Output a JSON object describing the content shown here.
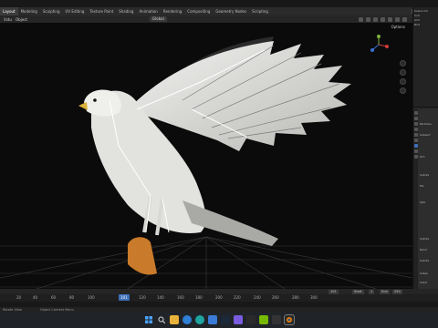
{
  "workspaces": [
    "Layout",
    "Modeling",
    "Sculpting",
    "UV Editing",
    "Texture Paint",
    "Shading",
    "Animation",
    "Rendering",
    "Compositing",
    "Geometry Nodes",
    "Scripting"
  ],
  "scene_label": "Scene",
  "header": {
    "view": "Vstu",
    "object": "Object",
    "orientation": "Global"
  },
  "viewport": {
    "options_label": "Options"
  },
  "outliner": {
    "rows": [
      "Scene Col",
      "Coll",
      "Arm",
      "Bird"
    ]
  },
  "properties": {
    "rows": [
      "Particles",
      "Subsurf",
      "Ord",
      "Subdiv",
      "Fac",
      "Opti",
      "Subdiv",
      "Rend",
      "Subdiv",
      "Subsu",
      "Subd"
    ]
  },
  "timeline": {
    "frame_field": "101",
    "start_label": "Start",
    "start_value": "1",
    "end_label": "End",
    "end_value": "250",
    "ticks": [
      "20",
      "40",
      "60",
      "80",
      "100",
      "120",
      "140",
      "160",
      "180",
      "200",
      "220",
      "240",
      "260",
      "280",
      "300"
    ],
    "current": "101"
  },
  "status": {
    "left": "Rotate View",
    "mid": "Object Context Menu"
  },
  "colors": {
    "accent": "#3d6fb8",
    "viewport_bg": "#0b0b0b",
    "bird_white": "#e6e6e4",
    "bird_gray": "#9a9a98",
    "talon_orange": "#c97a2a"
  },
  "taskbar_icons": [
    "windows-logo-icon",
    "search-icon",
    "file-explorer-icon",
    "browser-icon",
    "edge-icon",
    "store-icon",
    "steam-icon",
    "photos-icon",
    "media-icon",
    "nvidia-icon",
    "terminal-icon",
    "blender-icon"
  ]
}
